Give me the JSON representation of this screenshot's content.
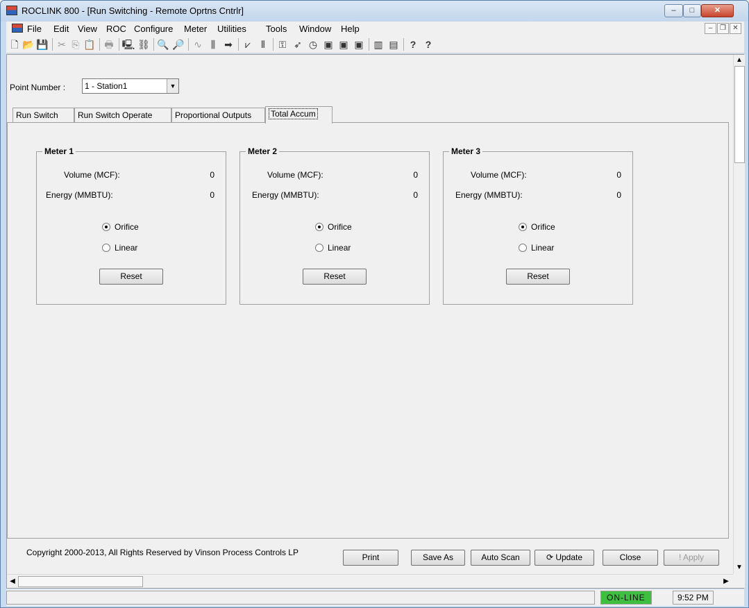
{
  "window": {
    "title": "ROCLINK 800 - [Run Switching - Remote Oprtns Cntrlr]",
    "min_label": "–",
    "max_label": "□",
    "close_label": "✕"
  },
  "menu": {
    "items": [
      "File",
      "Edit",
      "View",
      "ROC",
      "Configure",
      "Meter",
      "Utilities",
      "Tools",
      "Window",
      "Help"
    ],
    "mdi_min": "–",
    "mdi_restore": "❐",
    "mdi_close": "✕"
  },
  "toolbar": {
    "icons": [
      "new-icon",
      "open-icon",
      "save-icon",
      "cut-icon",
      "copy-icon",
      "paste-icon",
      "print-icon",
      "connect-icon",
      "directory-icon",
      "zoom-in-icon",
      "zoom-out-icon",
      "trend-icon",
      "io-icon",
      "pid-icon",
      "meter-icon",
      "history-icon",
      "key-icon",
      "rocket-icon",
      "clock-icon",
      "display1-icon",
      "display2-icon",
      "display3-icon",
      "chart-icon",
      "report-icon",
      "help-icon",
      "context-help-icon"
    ],
    "glyphs": [
      "🗋",
      "📂",
      "💾",
      "✂",
      "⎘",
      "📋",
      "🖶",
      "🖳",
      "⛓",
      "🔍",
      "🔎",
      "∿",
      "⫼",
      "➡",
      "⩗",
      "⫴",
      "⚿",
      "➶",
      "◷",
      "▣",
      "▣",
      "▣",
      "▥",
      "▤",
      "?",
      "?"
    ]
  },
  "point": {
    "label": "Point Number :",
    "value": "1 - Station1",
    "dropdown_arrow": "▼"
  },
  "tabs": [
    "Run Switch",
    "Run Switch Operate",
    "Proportional Outputs",
    "Total Accum"
  ],
  "meters": [
    {
      "title": "Meter 1",
      "volume_label": "Volume (MCF):",
      "volume": "0",
      "energy_label": "Energy (MMBTU):",
      "energy": "0",
      "orifice": "Orifice",
      "linear": "Linear",
      "reset": "Reset",
      "selected": "orifice"
    },
    {
      "title": "Meter 2",
      "volume_label": "Volume (MCF):",
      "volume": "0",
      "energy_label": "Energy (MMBTU):",
      "energy": "0",
      "orifice": "Orifice",
      "linear": "Linear",
      "reset": "Reset",
      "selected": "orifice"
    },
    {
      "title": "Meter 3",
      "volume_label": "Volume (MCF):",
      "volume": "0",
      "energy_label": "Energy (MMBTU):",
      "energy": "0",
      "orifice": "Orifice",
      "linear": "Linear",
      "reset": "Reset",
      "selected": "orifice"
    }
  ],
  "footer": {
    "copyright": "Copyright 2000-2013, All Rights Reserved by Vinson Process Controls LP",
    "print": "Print",
    "save_as": "Save As",
    "auto_scan": "Auto Scan",
    "update": "Update",
    "close": "Close",
    "apply": "Apply"
  },
  "status": {
    "connection": "ON-LINE",
    "time": "9:52 PM"
  },
  "colors": {
    "online": "#3fbf3f",
    "titlebar": "#c3d6ec"
  }
}
